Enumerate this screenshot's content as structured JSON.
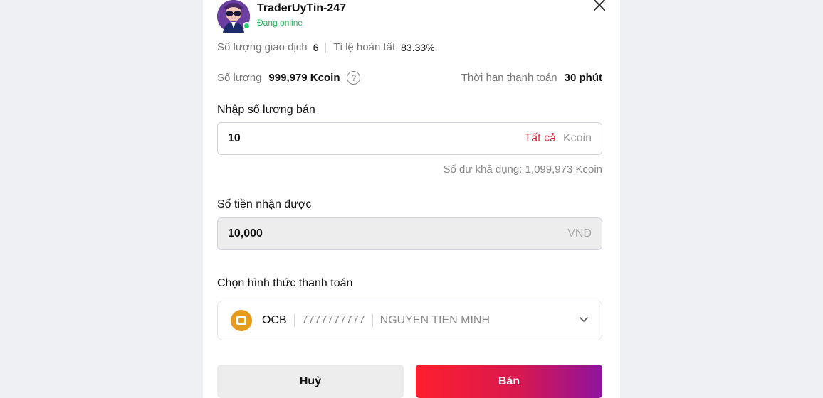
{
  "trader": {
    "name": "TraderUyTin-247",
    "status": "Đang online"
  },
  "stats": {
    "trades_label": "Số lượng giao dịch",
    "trades_value": "6",
    "completion_label": "Tỉ lệ hoàn tất",
    "completion_value": "83.33%"
  },
  "offer": {
    "amount_label": "Số lượng",
    "amount_value": "999,979 Kcoin",
    "help_icon": "?",
    "deadline_label": "Thời hạn thanh toán",
    "deadline_value": "30 phút"
  },
  "sell_input": {
    "label": "Nhập số lượng bán",
    "value": "10",
    "all_label": "Tất cả",
    "unit": "Kcoin",
    "balance_text": "Số dư khả dụng: 1,099,973 Kcoin"
  },
  "receive": {
    "label": "Số tiền nhận được",
    "value": "10,000",
    "unit": "VND"
  },
  "payment": {
    "label": "Chọn hình thức thanh toán",
    "bank": "OCB",
    "account_number": "7777777777",
    "account_name": "NGUYEN TIEN MINH"
  },
  "actions": {
    "cancel_label": "Huỷ",
    "sell_label": "Bán"
  },
  "colors": {
    "accent_red": "#e0243a",
    "online_green": "#20b35a",
    "sell_gradient_start": "#ff1f2e",
    "sell_gradient_end": "#8e13a0",
    "bank_logo": "#e89a1f"
  },
  "icons": {
    "close": "close-icon",
    "help": "question-circle-icon",
    "chevron": "chevron-down-icon",
    "bank_logo": "ocb-logo-icon"
  }
}
